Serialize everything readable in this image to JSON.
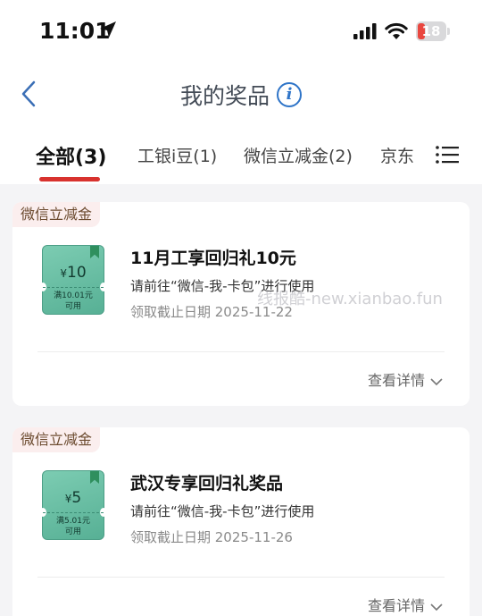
{
  "status_bar": {
    "time": "11:01",
    "battery": "18"
  },
  "header": {
    "title": "我的奖品"
  },
  "tabs": [
    {
      "label": "全部(3)",
      "active": true
    },
    {
      "label": "工银i豆(1)"
    },
    {
      "label": "微信立减金(2)"
    },
    {
      "label": "京东"
    }
  ],
  "prizes": [
    {
      "tag": "微信立减金",
      "coupon_amount": "10",
      "coupon_condition_line1": "满10.01元",
      "coupon_condition_line2": "可用",
      "name": "11月工享回归礼10元",
      "description": "请前往“微信-我-卡包”进行使用",
      "deadline": "领取截止日期 2025-11-22",
      "detail_label": "查看详情"
    },
    {
      "tag": "微信立减金",
      "coupon_amount": "5",
      "coupon_condition_line1": "满5.01元",
      "coupon_condition_line2": "可用",
      "name": "武汉专享回归礼奖品",
      "description": "请前往“微信-我-卡包”进行使用",
      "deadline": "领取截止日期 2025-11-26",
      "detail_label": "查看详情"
    }
  ],
  "currency_symbol": "¥",
  "watermark": "线报酷-new.xianbao.fun"
}
